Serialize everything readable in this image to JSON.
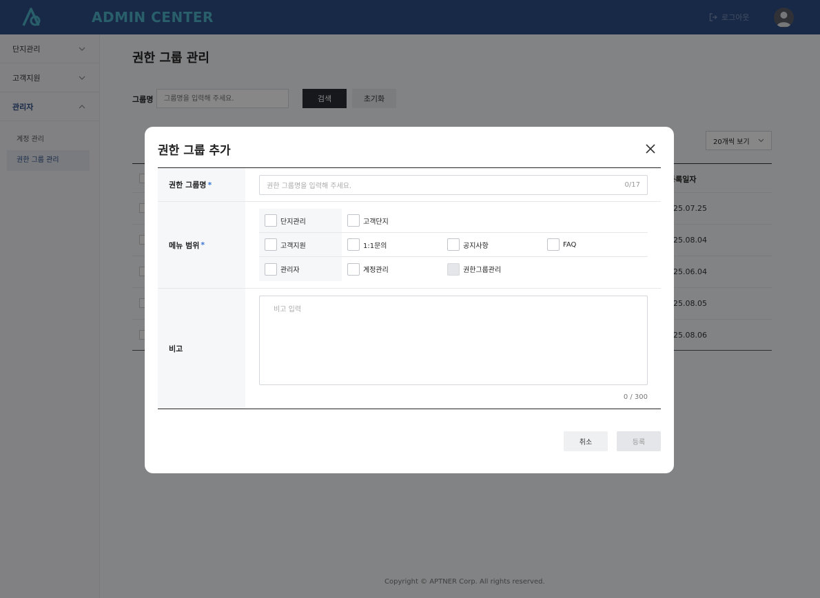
{
  "header": {
    "brand": "ADMIN CENTER",
    "logout_label": "로그아웃"
  },
  "sidebar": {
    "menus": [
      {
        "label": "단지관리"
      },
      {
        "label": "고객지원"
      },
      {
        "label": "관리자"
      }
    ],
    "subitems": [
      {
        "label": "계정 관리"
      },
      {
        "label": "권한 그룹 관리"
      }
    ]
  },
  "page": {
    "title": "권한 그룹 관리",
    "filter_label": "그룹명",
    "filter_placeholder": "그룹명을 입력해 주세요.",
    "search_label": "검색",
    "reset_label": "초기화",
    "page_size": "20개씩 보기",
    "date_header": "등록일자",
    "dates": [
      "25.07.25",
      "25.08.04",
      "25.06.04",
      "25.08.05",
      "25.08.06"
    ],
    "footer": "Copyright © APTNER Corp. All rights reserved."
  },
  "modal": {
    "title": "권한 그룹 추가",
    "name_label": "권한 그룹명",
    "required_mark": "*",
    "name_placeholder": "권한 그룹명을 입력해 주세요.",
    "name_count": "0/17",
    "menu_label": "메뉴 범위",
    "menu_groups": [
      {
        "parent": "단지관리",
        "children": [
          "고객단지"
        ]
      },
      {
        "parent": "고객지원",
        "children": [
          "1:1문의",
          "공지사항",
          "FAQ"
        ]
      },
      {
        "parent": "관리자",
        "children": [
          "계정관리",
          "권한그룹관리"
        ]
      }
    ],
    "memo_label": "비고",
    "memo_placeholder": "비고 입력",
    "memo_count": "0 / 300",
    "cancel_label": "취소",
    "submit_label": "등록"
  },
  "colors": {
    "header_bg": "#2f4f86",
    "brand": "#4fb3c9",
    "required": "#3a76d8"
  }
}
